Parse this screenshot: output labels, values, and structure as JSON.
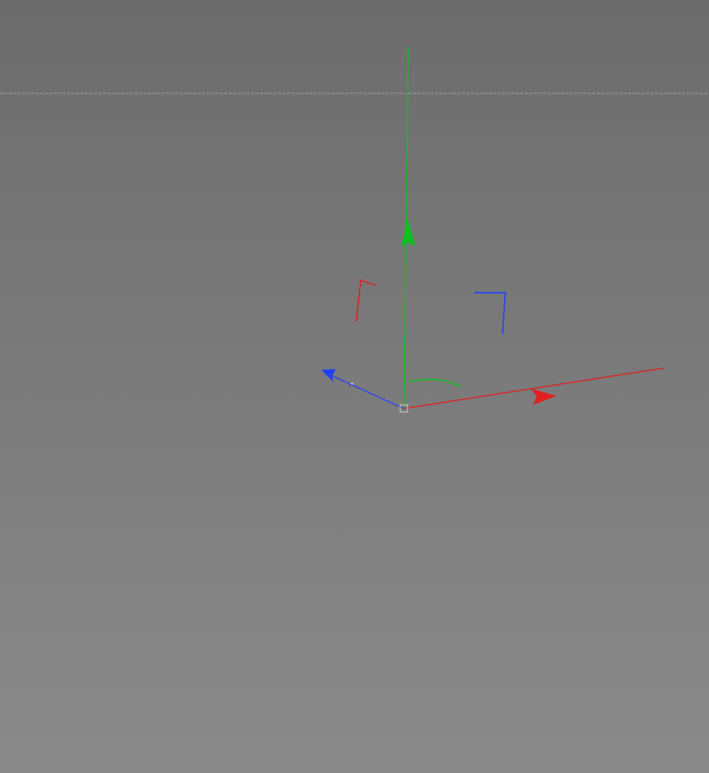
{
  "viewport": {
    "background_top": "#6c6c6c",
    "background_bottom": "#8a8a8a",
    "horizon_line_color": "#a0a0a0"
  },
  "wheel": {
    "spoke_count": 5,
    "rim_segments": 24,
    "hub_segments": 12,
    "fill_color": "#555b63",
    "fill_color_dark": "#464b51",
    "edge_color": "#dfe3e8",
    "gap_color": "#121212"
  },
  "gizmo": {
    "x_axis_color": "#e02020",
    "y_axis_color": "#10c020",
    "z_axis_color": "#2040ff",
    "origin_color": "#c8c8c8"
  }
}
